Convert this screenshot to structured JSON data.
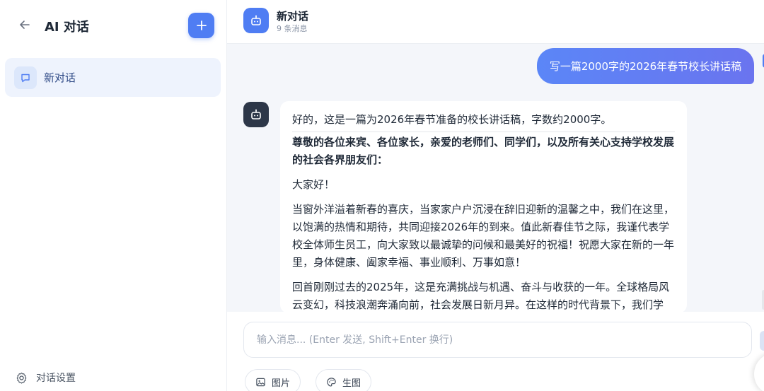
{
  "sidebar": {
    "title": "AI 对话",
    "back_icon": "arrow-left-icon",
    "new_icon": "plus-icon",
    "conversations": [
      {
        "label": "新对话",
        "icon": "chat-bubble-icon"
      }
    ],
    "footer": {
      "label": "对话设置",
      "icon": "gear-icon"
    }
  },
  "chat": {
    "title": "新对话",
    "subtitle": "9 条消息",
    "bot_icon": "robot-icon",
    "user_message": "写一篇2000字的2026年春节校长讲话稿",
    "bot_message": {
      "intro": "好的，这是一篇为2026年春节准备的校长讲话稿，字数约2000字。",
      "salutation": "尊敬的各位来宾、各位家长，亲爱的老师们、同学们，以及所有关心支持学校发展的社会各界朋友们：",
      "greeting": "大家好！",
      "para1": "当窗外洋溢着新春的喜庆，当家家户户沉浸在辞旧迎新的温馨之中，我们在这里，以饱满的热情和期待，共同迎接2026年的到来。值此新春佳节之际，我谨代表学校全体师生员工，向大家致以最诚挚的问候和最美好的祝福！祝愿大家在新的一年里，身体健康、阖家幸福、事业顺利、万事如意！",
      "para2": "回首刚刚过去的2025年，这是充满挑战与机遇、奋斗与收获的一年。全球格局风云变幻，科技浪潮奔涌向前，社会发展日新月异。在这样的时代背景下，我们学"
    }
  },
  "composer": {
    "placeholder": "输入消息... (Enter 发送, Shift+Enter 换行)",
    "value": "",
    "tools": [
      {
        "label": "图片",
        "icon": "image-icon"
      },
      {
        "label": "生图",
        "icon": "palette-icon"
      }
    ]
  },
  "colors": {
    "accent": "#4f7df3",
    "user_bubble_start": "#5b86f7",
    "user_bubble_end": "#6a74ef",
    "bot_avatar": "#2d3748",
    "active_item": "#eef3fd"
  }
}
